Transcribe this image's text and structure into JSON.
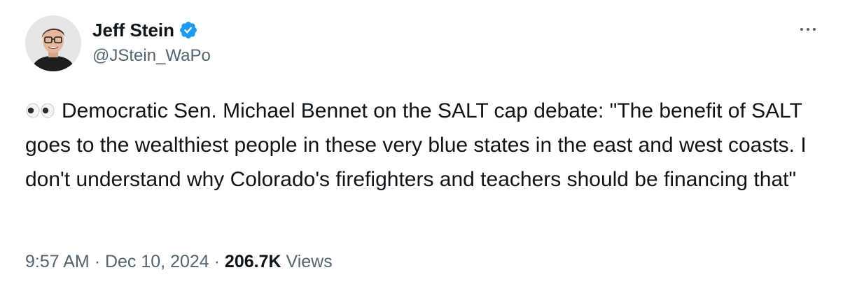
{
  "author": {
    "display_name": "Jeff Stein",
    "handle": "@JStein_WaPo",
    "verified": true,
    "avatar_icon": "person-avatar",
    "verified_icon": "verified-badge-icon",
    "verified_color": "#1d9bf0"
  },
  "menu": {
    "icon": "more-options-icon"
  },
  "tweet": {
    "emoji_icon": "eyes-emoji",
    "text": "Democratic Sen. Michael Bennet on the SALT cap debate: \"The benefit of SALT goes to the wealthiest people in these very blue states in the east and west coasts. I don't understand why Colorado's firefighters and teachers should be financing that\""
  },
  "meta": {
    "time": "9:57 AM",
    "separator": "·",
    "date": "Dec 10, 2024",
    "views_count": "206.7K",
    "views_label": "Views"
  },
  "colors": {
    "text_primary": "#0f1419",
    "text_secondary": "#536471",
    "background": "#ffffff"
  }
}
